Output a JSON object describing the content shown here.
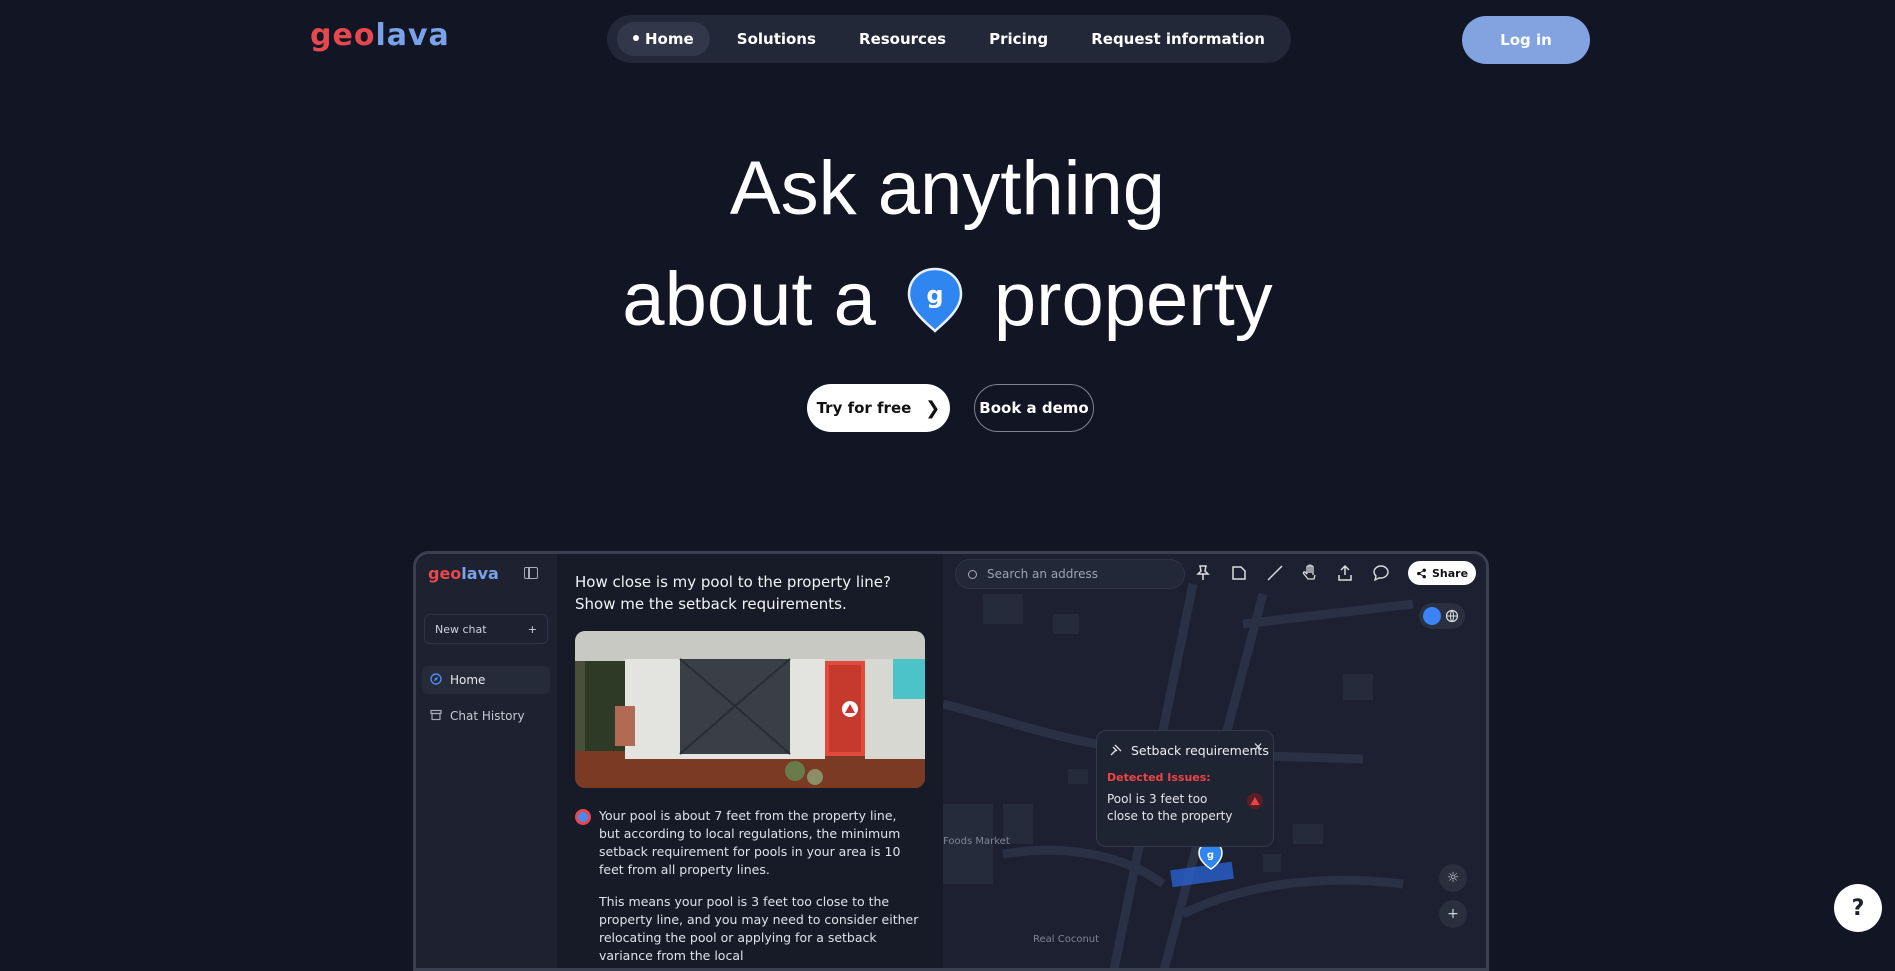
{
  "brand": {
    "logo_geo": "geo",
    "logo_lava": "lava",
    "accent_red": "#e5484d",
    "accent_blue": "#7aa2e8"
  },
  "nav": {
    "items": [
      {
        "label": "Home",
        "active": true
      },
      {
        "label": "Solutions"
      },
      {
        "label": "Resources"
      },
      {
        "label": "Pricing"
      },
      {
        "label": "Request information"
      }
    ]
  },
  "login_label": "Log in",
  "hero": {
    "line1": "Ask anything",
    "line2_before": "about a",
    "line2_after": "property",
    "pin_icon": "map-pin-icon"
  },
  "cta": {
    "try_label": "Try for free",
    "demo_label": "Book a demo"
  },
  "app": {
    "logo_geo": "geo",
    "logo_lava": "lava",
    "new_chat": "New chat",
    "sidebar": [
      {
        "label": "Home",
        "icon": "compass-icon"
      },
      {
        "label": "Chat History",
        "icon": "archive-icon"
      }
    ],
    "question": "How close is my pool to the property line? Show me the setback requirements.",
    "answer_p1": "Your pool is about 7 feet from the property line, but according to local regulations, the minimum setback requirement for pools in your area is 10 feet from all property lines.",
    "answer_p2": "This means your pool is 3 feet too close to the property line, and you may need to consider either relocating the pool or applying for a setback variance from the local",
    "search_placeholder": "Search an address",
    "share_label": "Share",
    "popup": {
      "title": "Setback requirements",
      "issues_label": "Detected Issues:",
      "message": "Pool is 3 feet too close to the property"
    },
    "map_labels": {
      "market": "Foods Market",
      "coconut": "Real Coconut"
    }
  },
  "help_label": "?"
}
